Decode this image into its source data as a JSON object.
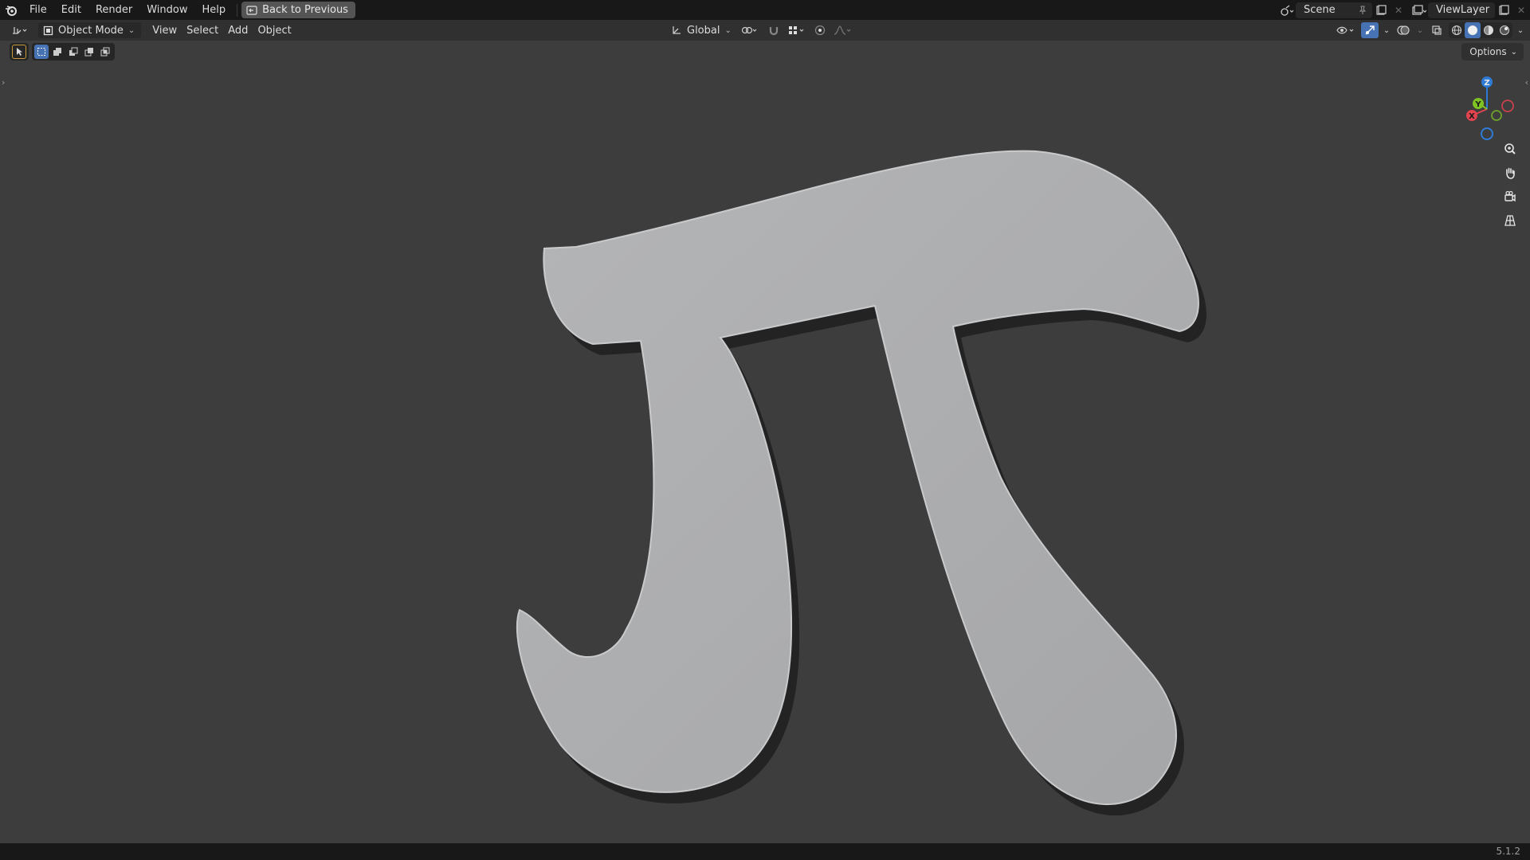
{
  "topbar": {
    "menus": [
      "File",
      "Edit",
      "Render",
      "Window",
      "Help"
    ],
    "back_button": "Back to Previous",
    "scene_name": "Scene",
    "view_layer": "ViewLayer"
  },
  "header": {
    "mode": "Object Mode",
    "menus": [
      "View",
      "Select",
      "Add",
      "Object"
    ],
    "transform_orientation": "Global"
  },
  "viewport": {
    "options_label": "Options",
    "gizmo_axes": {
      "z": "Z",
      "y": "Y",
      "x": "X"
    },
    "object": "π"
  },
  "statusbar": {
    "version": "5.1.2"
  },
  "colors": {
    "accent": "#4772b3",
    "axis_x": "#e1434f",
    "axis_y": "#7fc224",
    "axis_z": "#2e7bd6",
    "background": "#3d3d3d"
  }
}
